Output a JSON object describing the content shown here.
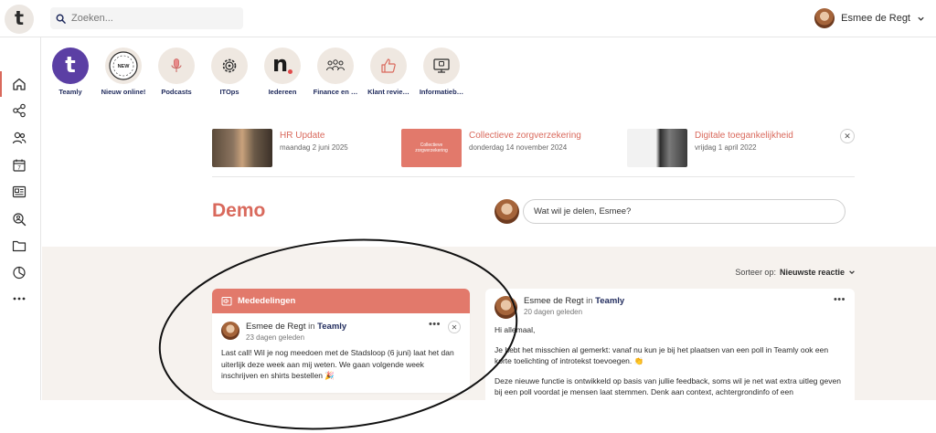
{
  "app": {
    "logo_letter": "t"
  },
  "search": {
    "placeholder": "Zoeken..."
  },
  "user": {
    "name": "Esmee de Regt"
  },
  "sidebar": {
    "items": [
      {
        "name": "home-icon"
      },
      {
        "name": "network-icon"
      },
      {
        "name": "people-icon"
      },
      {
        "name": "calendar-icon",
        "day": "7"
      },
      {
        "name": "news-icon"
      },
      {
        "name": "search-people-icon"
      },
      {
        "name": "folder-icon"
      },
      {
        "name": "chart-icon"
      },
      {
        "name": "more-icon"
      }
    ]
  },
  "channels": [
    {
      "label": "Teamly",
      "icon": "teamly-logo"
    },
    {
      "label": "Nieuw online!",
      "icon": "new-badge-icon"
    },
    {
      "label": "Podcasts",
      "icon": "microphone-icon"
    },
    {
      "label": "ITOps",
      "icon": "gear-icon"
    },
    {
      "label": "Iedereen",
      "icon": "n-logo"
    },
    {
      "label": "Finance en …",
      "icon": "group-icon"
    },
    {
      "label": "Klant revie…",
      "icon": "thumbs-up-icon"
    },
    {
      "label": "Informatieb…",
      "icon": "monitor-icon"
    }
  ],
  "featured": [
    {
      "title": "HR Update",
      "date": "maandag 2 juni 2025"
    },
    {
      "title": "Collectieve zorgverzekering",
      "date": "donderdag 14 november 2024",
      "thumb_text": "Collectieve zorgverzekering"
    },
    {
      "title": "Digitale toegankelijkheid",
      "date": "vrijdag 1 april 2022"
    }
  ],
  "page": {
    "title": "Demo"
  },
  "compose": {
    "placeholder": "Wat wil je delen, Esmee?"
  },
  "sort": {
    "label": "Sorteer op:",
    "value": "Nieuwste reactie"
  },
  "announcements": {
    "header": "Mededelingen",
    "post": {
      "author": "Esmee de Regt",
      "in": "in",
      "channel": "Teamly",
      "ago": "23 dagen geleden",
      "text": "Last call! Wil je nog meedoen met de Stadsloop (6 juni) laat het dan uiterlijk deze week aan mij weten. We gaan volgende week inschrijven en shirts bestellen 🎉"
    }
  },
  "feed_post": {
    "author": "Esmee de Regt",
    "in": "in",
    "channel": "Teamly",
    "ago": "20 dagen geleden",
    "p1": "Hi allemaal,",
    "p2": "Je hebt het misschien al gemerkt: vanaf nu kun je bij het plaatsen van een poll in Teamly ook een korte toelichting of introtekst toevoegen. 👏",
    "p3": "Deze nieuwe functie is ontwikkeld op basis van jullie feedback, soms wil je net wat extra uitleg geven bij een poll voordat je mensen laat stemmen. Denk aan context, achtergrondinfo of een"
  },
  "colors": {
    "accent": "#d9695c",
    "navy": "#1f2a5c",
    "announcement": "#e2796b",
    "feed_bg": "#f6f2ee"
  }
}
